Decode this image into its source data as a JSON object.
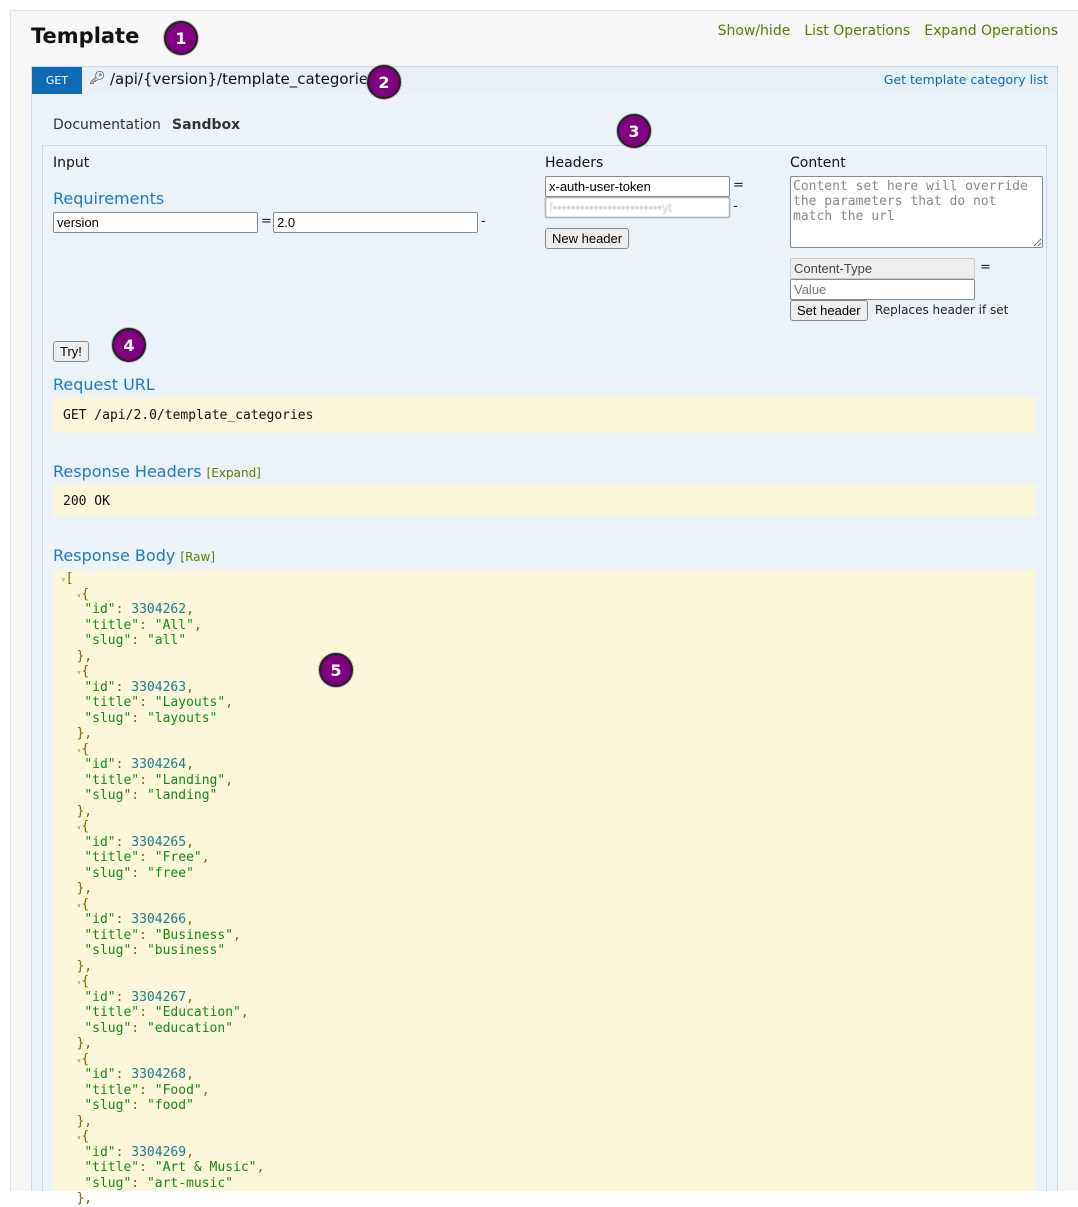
{
  "section": {
    "title": "Template",
    "links": [
      "Show/hide",
      "List Operations",
      "Expand Operations"
    ]
  },
  "operation": {
    "method": "GET",
    "path": "/api/{version}/template_categories",
    "summary": "Get template category list",
    "icon": "key-icon"
  },
  "tabs": [
    "Documentation",
    "Sandbox"
  ],
  "sandbox": {
    "input_label": "Input",
    "requirements_label": "Requirements",
    "req_name": "version",
    "req_value": "2.0",
    "headers_label": "Headers",
    "header_name": "x-auth-user-token",
    "header_value": "f••••••••••••••••••••••••yt",
    "new_header": "New header",
    "content_label": "Content",
    "content_placeholder": "Content set here will override the parameters that do not match the url",
    "content_type": "Content-Type",
    "value_placeholder": "Value",
    "set_header": "Set header",
    "set_header_note": "Replaces header if set",
    "try": "Try!"
  },
  "request_url": {
    "label": "Request URL",
    "value": "GET /api/2.0/template_categories"
  },
  "response_headers": {
    "label": "Response Headers",
    "toggle": "[Expand]",
    "value": "200 OK"
  },
  "response_body": {
    "label": "Response Body",
    "toggle": "[Raw]",
    "items": [
      {
        "id": 3304262,
        "title": "All",
        "slug": "all"
      },
      {
        "id": 3304263,
        "title": "Layouts",
        "slug": "layouts"
      },
      {
        "id": 3304264,
        "title": "Landing",
        "slug": "landing"
      },
      {
        "id": 3304265,
        "title": "Free",
        "slug": "free"
      },
      {
        "id": 3304266,
        "title": "Business",
        "slug": "business"
      },
      {
        "id": 3304267,
        "title": "Education",
        "slug": "education"
      },
      {
        "id": 3304268,
        "title": "Food",
        "slug": "food"
      },
      {
        "id": 3304269,
        "title": "Art & Music",
        "slug": "art-music"
      }
    ]
  },
  "markers": [
    "1",
    "2",
    "3",
    "4",
    "5"
  ],
  "colors": {
    "method_get": "#0f6ab4",
    "link_green": "#547f00",
    "heading_blue": "#1f7ac4",
    "marker": "#800080",
    "code_bg": "#fcf6db"
  }
}
